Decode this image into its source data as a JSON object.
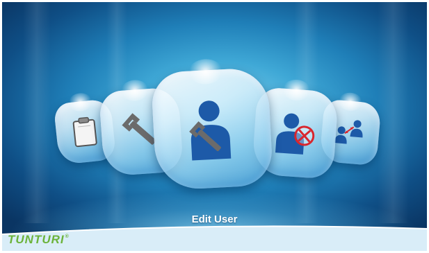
{
  "carousel": {
    "selected_label": "Edit User",
    "items": [
      {
        "icon": "clipboard-icon"
      },
      {
        "icon": "wrench-icon"
      },
      {
        "icon": "user-wrench-icon"
      },
      {
        "icon": "user-delete-icon"
      },
      {
        "icon": "user-transfer-icon"
      }
    ]
  },
  "footer": {
    "brand": "TUNTURI",
    "registered": "®"
  },
  "colors": {
    "icon_blue": "#1d5aa8",
    "icon_gray": "#6b6b6b",
    "brand_green": "#6bb33a",
    "delete_red": "#d8262e"
  }
}
